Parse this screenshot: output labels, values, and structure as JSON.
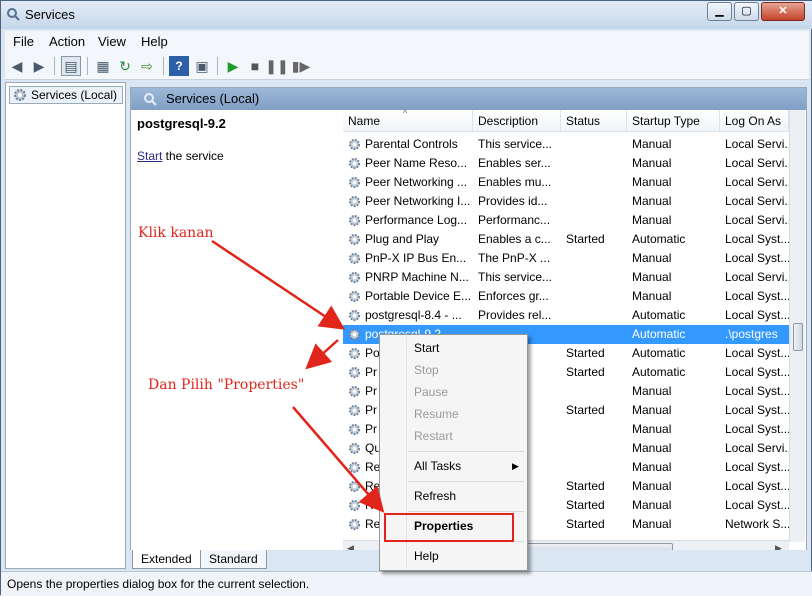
{
  "window": {
    "title": "Services"
  },
  "menu": [
    "File",
    "Action",
    "View",
    "Help"
  ],
  "tree": {
    "item": "Services (Local)"
  },
  "pane": {
    "header": "Services (Local)",
    "service_name": "postgresql-9.2",
    "start_link": "Start",
    "start_suffix": " the service"
  },
  "columns": [
    "Name",
    "Description",
    "Status",
    "Startup Type",
    "Log On As"
  ],
  "rows": [
    {
      "name": "Parental Controls",
      "desc": "This service...",
      "status": "",
      "startup": "Manual",
      "logon": "Local Servi..."
    },
    {
      "name": "Peer Name Reso...",
      "desc": "Enables ser...",
      "status": "",
      "startup": "Manual",
      "logon": "Local Servi..."
    },
    {
      "name": "Peer Networking ...",
      "desc": "Enables mu...",
      "status": "",
      "startup": "Manual",
      "logon": "Local Servi..."
    },
    {
      "name": "Peer Networking I...",
      "desc": "Provides id...",
      "status": "",
      "startup": "Manual",
      "logon": "Local Servi..."
    },
    {
      "name": "Performance Log...",
      "desc": "Performanc...",
      "status": "",
      "startup": "Manual",
      "logon": "Local Servi..."
    },
    {
      "name": "Plug and Play",
      "desc": "Enables a c...",
      "status": "Started",
      "startup": "Automatic",
      "logon": "Local Syst..."
    },
    {
      "name": "PnP-X IP Bus En...",
      "desc": "The PnP-X ...",
      "status": "",
      "startup": "Manual",
      "logon": "Local Syst..."
    },
    {
      "name": "PNRP Machine N...",
      "desc": "This service...",
      "status": "",
      "startup": "Manual",
      "logon": "Local Servi..."
    },
    {
      "name": "Portable Device E...",
      "desc": "Enforces gr...",
      "status": "",
      "startup": "Manual",
      "logon": "Local Syst..."
    },
    {
      "name": "postgresql-8.4 - ...",
      "desc": "Provides rel...",
      "status": "",
      "startup": "Automatic",
      "logon": "Local Syst..."
    },
    {
      "name": "postgresql-9.2",
      "desc": "",
      "status": "",
      "startup": "Automatic",
      "logon": ".\\postgres",
      "selected": true
    },
    {
      "name": "Po",
      "desc": "s p...",
      "status": "Started",
      "startup": "Automatic",
      "logon": "Local Syst..."
    },
    {
      "name": "Pr",
      "desc": "es t...",
      "status": "Started",
      "startup": "Automatic",
      "logon": "Local Syst..."
    },
    {
      "name": "Pr",
      "desc": "ice...",
      "status": "",
      "startup": "Manual",
      "logon": "Local Syst..."
    },
    {
      "name": "Pr",
      "desc": "ice...",
      "status": "Started",
      "startup": "Manual",
      "logon": "Local Syst..."
    },
    {
      "name": "Pr",
      "desc": "ice...",
      "status": "",
      "startup": "Manual",
      "logon": "Local Syst..."
    },
    {
      "name": "Qu",
      "desc": "vin...",
      "status": "",
      "startup": "Manual",
      "logon": "Local Servi..."
    },
    {
      "name": "Re",
      "desc": "a c...",
      "status": "",
      "startup": "Manual",
      "logon": "Local Syst..."
    },
    {
      "name": "Re",
      "desc": "di...",
      "status": "Started",
      "startup": "Manual",
      "logon": "Local Syst..."
    },
    {
      "name": "Re",
      "desc": "De...",
      "status": "Started",
      "startup": "Manual",
      "logon": "Local Syst..."
    },
    {
      "name": "Re",
      "desc": "ser...",
      "status": "Started",
      "startup": "Manual",
      "logon": "Network S..."
    }
  ],
  "context_menu": {
    "start": "Start",
    "stop": "Stop",
    "pause": "Pause",
    "resume": "Resume",
    "restart": "Restart",
    "all_tasks": "All Tasks",
    "refresh": "Refresh",
    "properties": "Properties",
    "help": "Help"
  },
  "tabs": [
    "Extended",
    "Standard"
  ],
  "status": "Opens the properties dialog box for the current selection.",
  "annotations": {
    "right_click": "Klik kanan",
    "choose": "Dan Pilih \"Properties\""
  },
  "colors": {
    "selection": "#3399ff",
    "annotation": "#e1251b"
  },
  "icons": {
    "service": "gear-icon",
    "app": "services-icon"
  }
}
